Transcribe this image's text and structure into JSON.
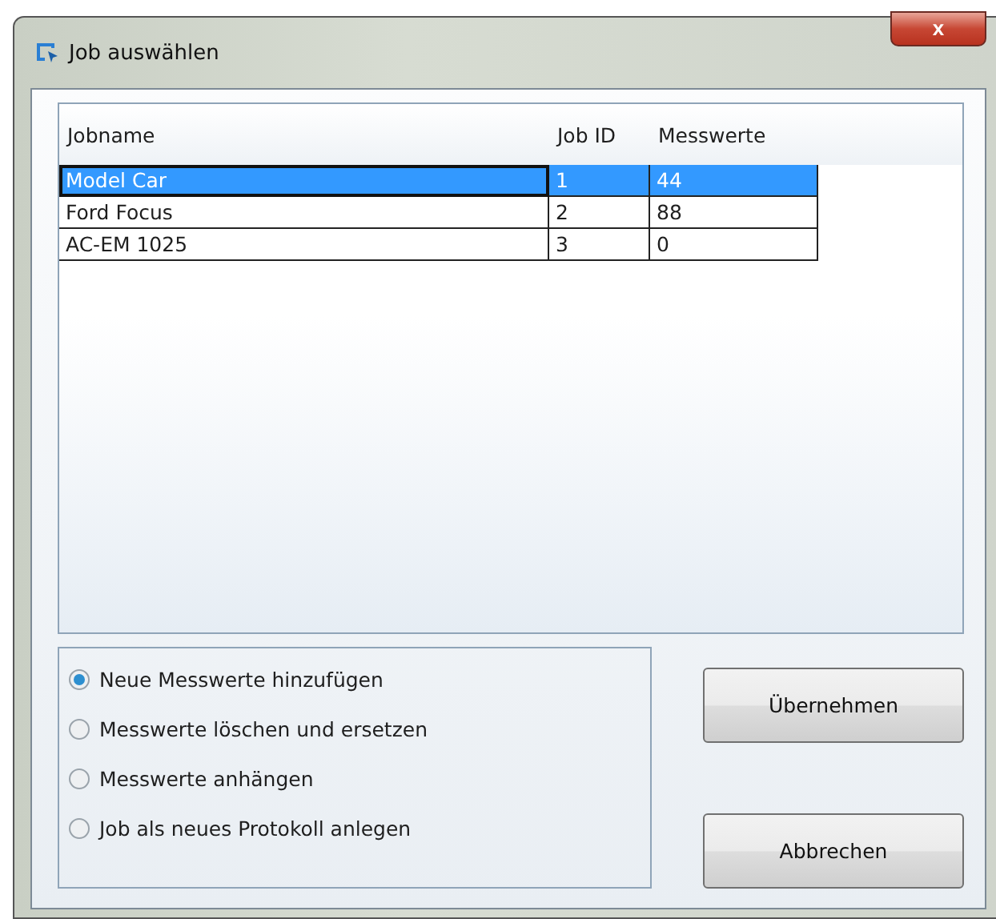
{
  "window": {
    "title": "Job auswählen",
    "close_label": "x"
  },
  "table": {
    "columns": [
      "Jobname",
      "Job ID",
      "Messwerte"
    ],
    "rows": [
      {
        "cells": [
          "Model Car",
          "1",
          "44"
        ],
        "selected": true
      },
      {
        "cells": [
          "Ford Focus",
          "2",
          "88"
        ],
        "selected": false
      },
      {
        "cells": [
          "AC-EM 1025",
          "3",
          "0"
        ],
        "selected": false
      }
    ]
  },
  "options": [
    {
      "label": "Neue Messwerte hinzufügen",
      "selected": true
    },
    {
      "label": "Messwerte löschen und ersetzen",
      "selected": false
    },
    {
      "label": "Messwerte anhängen",
      "selected": false
    },
    {
      "label": "Job als neues Protokoll anlegen",
      "selected": false
    }
  ],
  "buttons": [
    "Übernehmen",
    "Abbrechen"
  ]
}
